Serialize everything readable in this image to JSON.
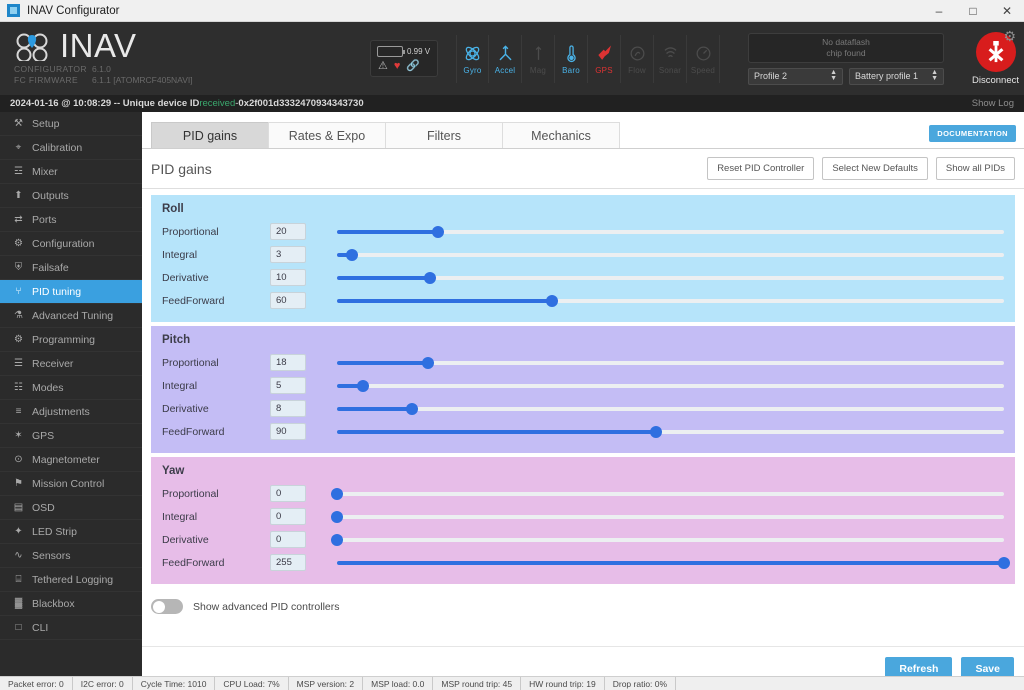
{
  "window": {
    "title": "INAV Configurator",
    "minimize": "–",
    "maximize": "□",
    "close": "✕"
  },
  "header": {
    "brand": "INAV",
    "configurator_label": "CONFIGURATOR",
    "configurator_version": "6.1.0",
    "firmware_label": "FC FIRMWARE",
    "firmware_version": "6.1.1 [ATOMRCF405NAVI]",
    "battery_voltage": "0.99 V",
    "dataflash_line1": "No dataflash",
    "dataflash_line2": "chip found",
    "profile": "Profile 2",
    "battery_profile": "Battery profile 1",
    "disconnect_label": "Disconnect",
    "sensors": [
      {
        "name": "Gyro",
        "state": "on"
      },
      {
        "name": "Accel",
        "state": "on"
      },
      {
        "name": "Mag",
        "state": "off"
      },
      {
        "name": "Baro",
        "state": "on"
      },
      {
        "name": "GPS",
        "state": "err"
      },
      {
        "name": "Flow",
        "state": "off"
      },
      {
        "name": "Sonar",
        "state": "off"
      },
      {
        "name": "Speed",
        "state": "off"
      }
    ]
  },
  "statusline": {
    "timestamp": "2024-01-16 @ 10:08:29 -- Unique device ID ",
    "received": "received",
    "dash": " - ",
    "device_id": "0x2f001d3332470934343730",
    "show_log": "Show Log"
  },
  "sidebar": {
    "items": [
      {
        "label": "Setup",
        "icon": "wrench-icon",
        "glyph": "⚒",
        "active": false
      },
      {
        "label": "Calibration",
        "icon": "crosshair-icon",
        "glyph": "⌖",
        "active": false
      },
      {
        "label": "Mixer",
        "icon": "mixer-icon",
        "glyph": "☲",
        "active": false
      },
      {
        "label": "Outputs",
        "icon": "outputs-icon",
        "glyph": "⬆",
        "active": false
      },
      {
        "label": "Ports",
        "icon": "ports-icon",
        "glyph": "⇄",
        "active": false
      },
      {
        "label": "Configuration",
        "icon": "gear-icon",
        "glyph": "⚙",
        "active": false
      },
      {
        "label": "Failsafe",
        "icon": "shield-icon",
        "glyph": "⛨",
        "active": false
      },
      {
        "label": "PID tuning",
        "icon": "sliders-icon",
        "glyph": "⑂",
        "active": true
      },
      {
        "label": "Advanced Tuning",
        "icon": "advanced-icon",
        "glyph": "⚗",
        "active": false
      },
      {
        "label": "Programming",
        "icon": "programming-icon",
        "glyph": "⚙",
        "active": false
      },
      {
        "label": "Receiver",
        "icon": "receiver-icon",
        "glyph": "☰",
        "active": false
      },
      {
        "label": "Modes",
        "icon": "modes-icon",
        "glyph": "☷",
        "active": false
      },
      {
        "label": "Adjustments",
        "icon": "adjustments-icon",
        "glyph": "≡",
        "active": false
      },
      {
        "label": "GPS",
        "icon": "satellite-icon",
        "glyph": "✶",
        "active": false
      },
      {
        "label": "Magnetometer",
        "icon": "compass-icon",
        "glyph": "⊙",
        "active": false
      },
      {
        "label": "Mission Control",
        "icon": "map-pin-icon",
        "glyph": "⚑",
        "active": false
      },
      {
        "label": "OSD",
        "icon": "osd-icon",
        "glyph": "▤",
        "active": false
      },
      {
        "label": "LED Strip",
        "icon": "led-icon",
        "glyph": "✦",
        "active": false
      },
      {
        "label": "Sensors",
        "icon": "waveform-icon",
        "glyph": "∿",
        "active": false
      },
      {
        "label": "Tethered Logging",
        "icon": "logging-icon",
        "glyph": "⌸",
        "active": false
      },
      {
        "label": "Blackbox",
        "icon": "blackbox-icon",
        "glyph": "▓",
        "active": false
      },
      {
        "label": "CLI",
        "icon": "terminal-icon",
        "glyph": "□",
        "active": false
      }
    ]
  },
  "tabs": [
    {
      "label": "PID gains",
      "active": true
    },
    {
      "label": "Rates & Expo",
      "active": false
    },
    {
      "label": "Filters",
      "active": false
    },
    {
      "label": "Mechanics",
      "active": false
    }
  ],
  "documentation_button": "DOCUMENTATION",
  "page": {
    "title": "PID gains",
    "buttons": [
      {
        "label": "Reset PID Controller"
      },
      {
        "label": "Select New Defaults"
      },
      {
        "label": "Show all PIDs"
      }
    ]
  },
  "pid_groups": [
    {
      "name": "Roll",
      "theme": "roll",
      "rows": [
        {
          "label": "Proportional",
          "value": "20",
          "percent": 15.2
        },
        {
          "label": "Integral",
          "value": "3",
          "percent": 2.3
        },
        {
          "label": "Derivative",
          "value": "10",
          "percent": 14.0
        },
        {
          "label": "FeedForward",
          "value": "60",
          "percent": 32.3
        }
      ]
    },
    {
      "name": "Pitch",
      "theme": "pitch",
      "rows": [
        {
          "label": "Proportional",
          "value": "18",
          "percent": 13.7
        },
        {
          "label": "Integral",
          "value": "5",
          "percent": 3.9
        },
        {
          "label": "Derivative",
          "value": "8",
          "percent": 11.2
        },
        {
          "label": "FeedForward",
          "value": "90",
          "percent": 47.9
        }
      ]
    },
    {
      "name": "Yaw",
      "theme": "yaw",
      "rows": [
        {
          "label": "Proportional",
          "value": "0",
          "percent": 0.0
        },
        {
          "label": "Integral",
          "value": "0",
          "percent": 0.0
        },
        {
          "label": "Derivative",
          "value": "0",
          "percent": 0.0
        },
        {
          "label": "FeedForward",
          "value": "255",
          "percent": 100.0
        }
      ]
    }
  ],
  "advanced_toggle": {
    "label": "Show advanced PID controllers",
    "enabled": false
  },
  "footer": {
    "refresh": "Refresh",
    "save": "Save"
  },
  "statusbar": [
    "Packet error: 0",
    "I2C error: 0",
    "Cycle Time: 1010",
    "CPU Load: 7%",
    "MSP version: 2",
    "MSP load: 0.0",
    "MSP round trip: 45",
    "HW round trip: 19",
    "Drop ratio: 0%"
  ],
  "colors": {
    "accent_blue": "#4aa7dd",
    "slider_blue": "#2f6fe0",
    "sidebar_active": "#3aa0e0",
    "roll_bg": "#b6e4fa",
    "pitch_bg": "#c4bdf5",
    "yaw_bg": "#e7bde8",
    "disconnect_red": "#d81d1d"
  }
}
